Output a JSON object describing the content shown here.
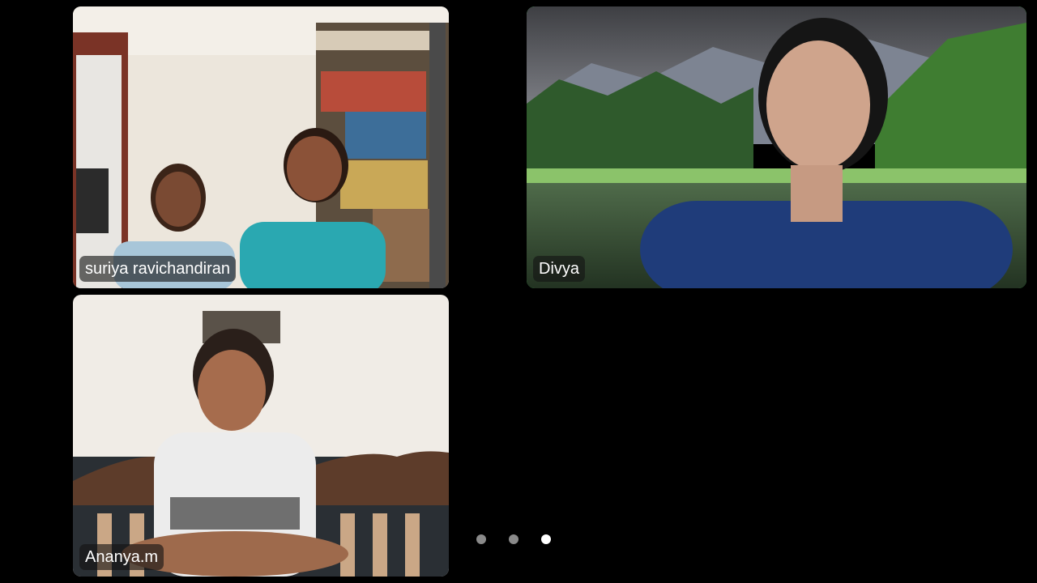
{
  "participants": [
    {
      "name": "suriya ravichandiran",
      "active_speaker": false
    },
    {
      "name": "Divya",
      "active_speaker": true
    },
    {
      "name": "Ananya.m",
      "active_speaker": false
    }
  ],
  "pagination": {
    "pages": 3,
    "current": 3
  },
  "colors": {
    "background": "#000000",
    "active_speaker_border": "#3bd05a",
    "page_dot": "#8a8a8a",
    "page_dot_active": "#ffffff"
  }
}
